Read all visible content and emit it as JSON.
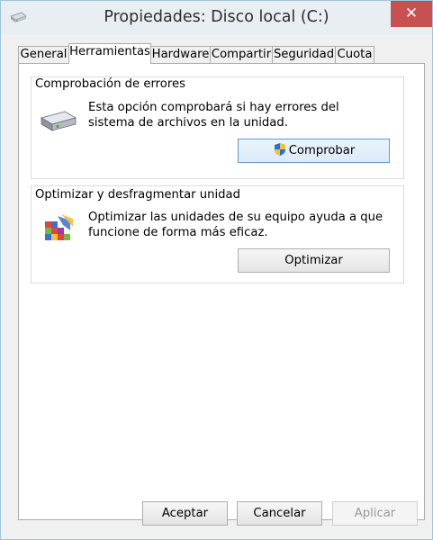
{
  "window": {
    "title": "Propiedades: Disco local (C:)",
    "close_glyph": "✕"
  },
  "tabs": [
    {
      "label": "General"
    },
    {
      "label": "Herramientas",
      "active": true
    },
    {
      "label": "Hardware"
    },
    {
      "label": "Compartir"
    },
    {
      "label": "Seguridad"
    },
    {
      "label": "Cuota"
    }
  ],
  "error_check": {
    "title": "Comprobación de errores",
    "desc1": "Esta opción comprobará si hay errores del",
    "desc2": "sistema de archivos en la unidad.",
    "button": "Comprobar",
    "icon": "hard-drive-icon"
  },
  "optimize": {
    "title": "Optimizar y desfragmentar unidad",
    "desc1": "Optimizar las unidades de su equipo ayuda a que",
    "desc2": "funcione de forma más eficaz.",
    "button": "Optimizar",
    "icon": "defrag-icon"
  },
  "footer": {
    "accept": "Aceptar",
    "cancel": "Cancelar",
    "apply": "Aplicar"
  },
  "colors": {
    "close_button": "#c75050",
    "title_bar": "#e9eef2",
    "focus_border": "#5b9bd5"
  }
}
